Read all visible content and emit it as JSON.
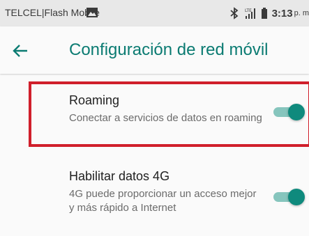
{
  "status_bar": {
    "carrier": "TELCEL|Flash Mobile",
    "time": "3:13",
    "time_suffix": "p. m",
    "icons": [
      "image-icon",
      "bluetooth-icon",
      "signal-4g-icon",
      "battery-icon"
    ]
  },
  "app_bar": {
    "back_icon": "arrow-back-icon",
    "title": "Configuración de red móvil",
    "accent_color": "#0b7b72"
  },
  "settings": [
    {
      "title": "Roaming",
      "summary": "Conectar a servicios de datos en roaming",
      "enabled": true
    },
    {
      "title": "Habilitar datos 4G",
      "summary": "4G puede proporcionar un acceso mejor y más rápido a Internet",
      "enabled": true
    }
  ],
  "highlight_color": "#d01f2b",
  "switch_color": "#0f8a7d"
}
